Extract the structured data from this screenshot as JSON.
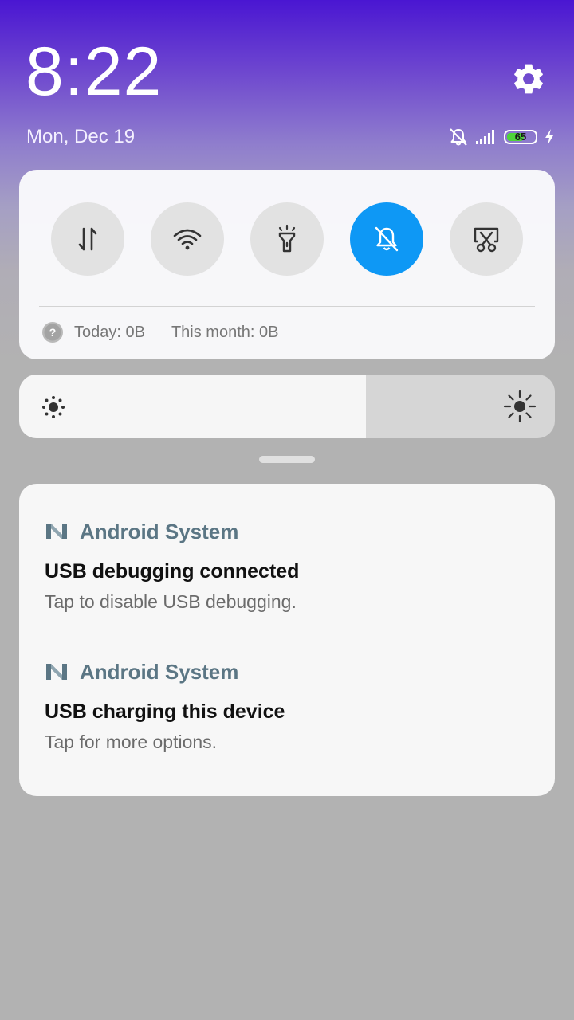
{
  "header": {
    "time": "8:22",
    "date": "Mon, Dec 19"
  },
  "status": {
    "battery_level": "65",
    "battery_fraction": 0.65,
    "icons": [
      "silent-mode-icon",
      "signal-icon",
      "battery-icon",
      "charging-icon"
    ]
  },
  "quick_settings": {
    "toggles": [
      {
        "name": "mobile-data",
        "icon": "data-arrows-icon",
        "active": false
      },
      {
        "name": "wifi",
        "icon": "wifi-icon",
        "active": false
      },
      {
        "name": "flashlight",
        "icon": "flashlight-icon",
        "active": false
      },
      {
        "name": "silent",
        "icon": "bell-off-icon",
        "active": true
      },
      {
        "name": "screenshot",
        "icon": "screenshot-scissors-icon",
        "active": false
      }
    ],
    "data_today": "Today: 0B",
    "data_month": "This month: 0B"
  },
  "brightness": {
    "level": 0.647
  },
  "notifications": [
    {
      "app": "Android System",
      "title": "USB debugging connected",
      "text": "Tap to disable USB debugging."
    },
    {
      "app": "Android System",
      "title": "USB charging this device",
      "text": "Tap for more options."
    }
  ],
  "colors": {
    "accent": "#0e98f5",
    "app_name": "#5b7684",
    "battery_fill": "#4fd43a"
  }
}
